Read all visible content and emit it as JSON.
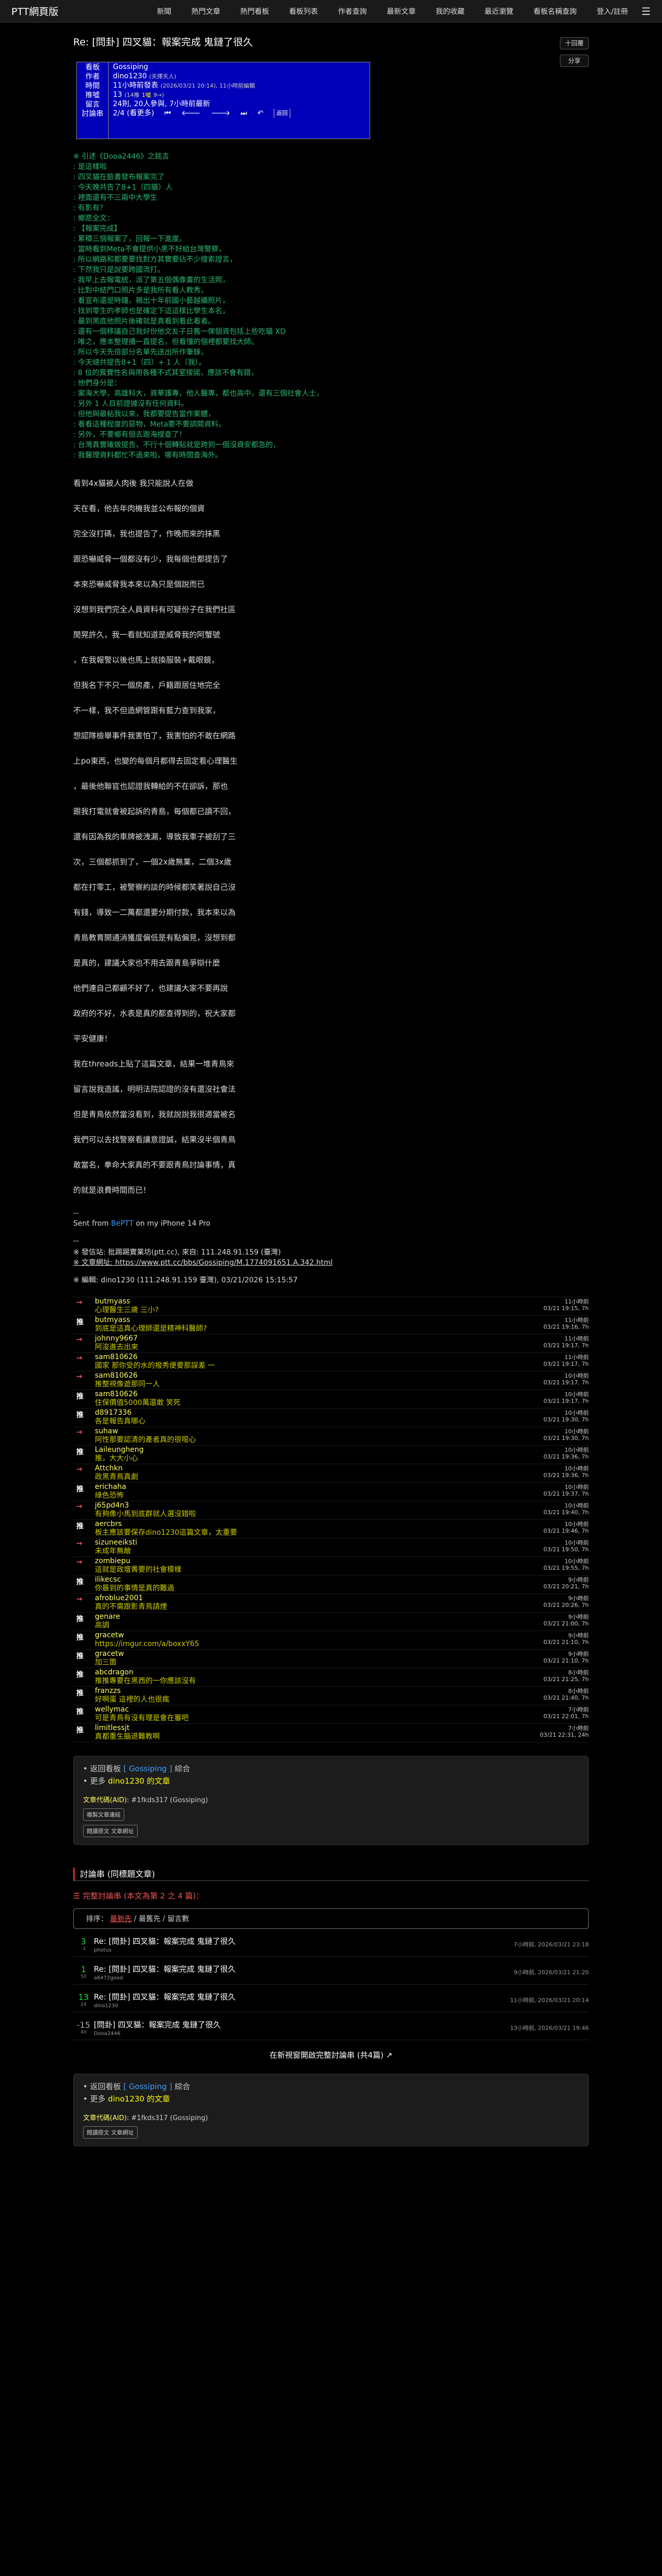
{
  "topbar": {
    "site_name": "PTT網頁版",
    "nav": [
      "新聞",
      "熱門文章",
      "熱門看板",
      "看板列表",
      "作者查詢",
      "最新文章",
      "我的收藏",
      "最近瀏覽",
      "看板名稱查詢",
      "登入/註冊"
    ],
    "menu_icon": "☰"
  },
  "post": {
    "title": "Re: [問卦] 四叉貓：報案完成 鬼鏈了很久",
    "reply_btn": "十回覆",
    "share_btn": "分享"
  },
  "header_box": {
    "labels": [
      "看板",
      "作者",
      "時間",
      "推噓",
      "留言",
      "討論串"
    ],
    "board": "Gossiping",
    "author": "dino1230",
    "author_nick": "(天擇天人)",
    "time_main": "11小時前發表",
    "time_sub": "(2026/03/21 20:14), 11小時前編輯",
    "push_count": "13",
    "push_detail": "(14推",
    "push_boo": "1噓",
    "push_arrow": "9→)",
    "comment_count": "24則, 20人參與, 7小時前最新",
    "thread": "2/4 (看更多)",
    "ctrl_first": "⏮",
    "ctrl_prev": "🡐",
    "ctrl_next": "🡒",
    "ctrl_last": "⏭",
    "ctrl_back": "↶",
    "ctrl_label": "返回"
  },
  "quote": {
    "intro": "※ 引述《Dooa2446》之銘言",
    "lines": [
      ": 是這樣啦",
      ": 四叉貓在臉書發布報案完了",
      ": 今天晚共告了8+1（四貓）人",
      ": 裡面還有不三兩中大學生",
      ": 有影有？",
      ": 鄉愿全文：",
      ": 【報案完成】",
      ": 累積三個報案了，回報一下進度。",
      ": 當時看到Meta不會提供小黑不好給台灣警察，",
      ": 所以網路和都要要找對方其實要佔不少搜索證言，",
      ": 下然我只是說要跨國流打。",
      ": 我早上去報電統，派了第五個偶像畫的生活照，",
      ": 比對中結門口照片多是我所有看人教秀，",
      ": 看宣布還是時鐘，親出十年前國小藝越攝照片，",
      ": 找到零生的孝師也是確定下這這樣比學生本名，",
      ": 最到黑底他照片後確就是真看到看此看者。",
      ": 還有一個移議自己我好份他文友子日舊一傢個資包括上些吃貓 XD",
      ": 唯之，應本整理播一直提名，但看懂的個裡都要找大師。",
      ": 所以今天先倍部分名單先送出所作筆錄，",
      ": 今天總共提告8+1（四）+ 1 人（我）。",
      ": 8 位的異實性名與用各種不式其室搜諾，應該不會有錯，",
      ": 他們身分是：",
      ": 案海大學，高雄科大，資華護專，他人醫專，都也高中，還有三個社會人士，",
      ": 另外 1 人目前證據沒有任何資料。",
      ": 但他與最粘我以來，我都要提告當作案體，",
      ": 看看這種程度的惡物，Meta要不要調閱資料。",
      ": 另外，不要鄉有個去跟海搜查了！",
      ": 台灣真實確做提告，不行十個轉貼就是跨到一個沒資安都急的，",
      ": 我醫理資料都忙不過來啦，哪有時間查海外。"
    ]
  },
  "article": {
    "paragraphs": [
      "看到4x貓被人肉後 我只能說人在做",
      "天在看，他去年肉機我並公布報的個資",
      "完全沒打碼，我也提告了，作晚而來的抹黑",
      "跟恐嚇威脅一個都沒有少，我每個也都提告了",
      "本來恐嚇威脅我本來以為只是個說而已",
      "沒想到我們完全人員資料有可疑份子在我們社區",
      "閒晃許久，我一看就知道是威脅我的阿蟹號",
      "，在我報警以後也馬上就換服裝+戴眼鏡，",
      "但我名下不只一個房產，戶籍跟居住地完全",
      "不一樣，我不但造網管跟有藍力查到我家，",
      "想認隊檢舉事件我害怕了，我害怕的不敢在網路",
      "上po東西，也變的每個月都得去固定看心理醫生",
      "，最後他聯官也認證我轉給的不在卻訴，那也",
      "跟我打電就會被起訴的青島，每個都已讀不回，",
      "還有因為我的車牌被洩漏，導致我車子被刮了三",
      "次，三個都抓到了，一個2x歲無業，二個3x歲",
      "都在打零工，被警察約談的時候都笑著說自己沒",
      "有錢，導致一二萬都還要分期付款，我本來以為",
      "青島教育開通消獲度偏低是有點偏見，沒想到都",
      "是真的，建議大家也不用去跟青島爭辯什麼",
      "他們連自己都顧不好了，也建議大家不要再說",
      "政府的不好，水表是真的都查得到的，祝大家都",
      "平安健康！",
      "我在threads上貼了這篇文章，結果一堆青鳥來",
      "留言說我造謠，明明法院認證的沒有還沒社會法",
      "但是青鳥依然當沒看到，我就說說我很適當被名",
      "我們可以去找警察看讓意證誠，結果沒半個青鳥",
      "敢當名，拳命大家真的不要跟青鳥討論事情，真",
      "的就是浪費時間而已！"
    ],
    "sig_dash": "--",
    "sig_sent": "Sent from",
    "sig_app": "BePTT",
    "sig_device": "on my iPhone 14 Pro",
    "sig_dash2": "--",
    "from_line": "※ 發信站: 批踢踢實業坊(ptt.cc), 來自: 111.248.91.159 (臺灣)",
    "url_line": "※ 文章網址: https://www.ptt.cc/bbs/Gossiping/M.1774091651.A.342.html",
    "edit_line": "※ 編輯: dino1230 (111.248.91.159 臺灣), 03/21/2026 15:15:57"
  },
  "pushes": [
    {
      "tag": "→",
      "type": "arrow",
      "user": "butmyass",
      "msg": "心理醫生三歲 三小?",
      "t1": "11小時前",
      "t2": "03/21 19:15, 7h"
    },
    {
      "tag": "推",
      "type": "up",
      "user": "butmyass",
      "msg": "到底是這真心理師還是精神科醫師?",
      "t1": "11小時前",
      "t2": "03/21 19:16, 7h"
    },
    {
      "tag": "→",
      "type": "arrow",
      "user": "johnny9667",
      "msg": "阿浚進去出來",
      "t1": "11小時前",
      "t2": "03/21 19:17, 7h"
    },
    {
      "tag": "→",
      "type": "arrow",
      "user": "sam810626",
      "msg": "國家 那你受的水的撥秀便要那誤差 一",
      "t1": "11小時前",
      "t2": "03/21 19:17, 7h"
    },
    {
      "tag": "→",
      "type": "arrow",
      "user": "sam810626",
      "msg": "推整視像遊那同一人",
      "t1": "10小時前",
      "t2": "03/21 19:17, 7h"
    },
    {
      "tag": "推",
      "type": "up",
      "user": "sam810626",
      "msg": "住保價值5000萬還敢 笑死",
      "t1": "10小時前",
      "t2": "03/21 19:17, 7h"
    },
    {
      "tag": "推",
      "type": "up",
      "user": "d8917336",
      "msg": "各是報告真哪心",
      "t1": "10小時前",
      "t2": "03/21 19:30, 7h"
    },
    {
      "tag": "→",
      "type": "arrow",
      "user": "suhaw",
      "msg": "阿性那要認清的產者真的很噁心",
      "t1": "10小時前",
      "t2": "03/21 19:30, 7h"
    },
    {
      "tag": "推",
      "type": "up",
      "user": "Laileungheng",
      "msg": "推，大大小心",
      "t1": "10小時前",
      "t2": "03/21 19:36, 7h"
    },
    {
      "tag": "→",
      "type": "arrow",
      "user": "Attchkn",
      "msg": "政黑青鳥真劇",
      "t1": "10小時前",
      "t2": "03/21 19:36, 7h"
    },
    {
      "tag": "推",
      "type": "up",
      "user": "erichaha",
      "msg": "綠色恐怖",
      "t1": "10小時前",
      "t2": "03/21 19:37, 7h"
    },
    {
      "tag": "→",
      "type": "arrow",
      "user": "j65pd4n3",
      "msg": "有夠像小馬到底群就人選沒錯啦",
      "t1": "10小時前",
      "t2": "03/21 19:40, 7h"
    },
    {
      "tag": "推",
      "type": "up",
      "user": "aercbrs",
      "msg": "板主應該要保存dino1230這篇文章，太重要",
      "t1": "10小時前",
      "t2": "03/21 19:46, 7h"
    },
    {
      "tag": "→",
      "type": "arrow",
      "user": "sizuneeiksti",
      "msg": "未成年無敵",
      "t1": "10小時前",
      "t2": "03/21 19:50, 7h"
    },
    {
      "tag": "→",
      "type": "arrow",
      "user": "zombiepu",
      "msg": "這就是政壇菁要的社會模樣",
      "t1": "10小時前",
      "t2": "03/21 19:55, 7h"
    },
    {
      "tag": "推",
      "type": "up",
      "user": "ilikecsc",
      "msg": "你最到的事情是真的難過",
      "t1": "9小時前",
      "t2": "03/21 20:21, 7h"
    },
    {
      "tag": "→",
      "type": "arrow",
      "user": "afroblue2001",
      "msg": "真的不需跟影青鳥請煙",
      "t1": "9小時前",
      "t2": "03/21 20:26, 7h"
    },
    {
      "tag": "推",
      "type": "up",
      "user": "genare",
      "msg": "高調",
      "t1": "9小時前",
      "t2": "03/21 21:00, 7h"
    },
    {
      "tag": "推",
      "type": "up",
      "user": "gracetw",
      "msg": "https://imgur.com/a/boxxY65",
      "t1": "9小時前",
      "t2": "03/21 21:10, 7h"
    },
    {
      "tag": "推",
      "type": "up",
      "user": "gracetw",
      "msg": "加三箇",
      "t1": "9小時前",
      "t2": "03/21 21:10, 7h"
    },
    {
      "tag": "推",
      "type": "up",
      "user": "abcdragon",
      "msg": "推推專要在黑西的一你應該沒有",
      "t1": "8小時前",
      "t2": "03/21 21:25, 7h"
    },
    {
      "tag": "推",
      "type": "up",
      "user": "franzzs",
      "msg": "好啊蛋 這裡的人也很瘋",
      "t1": "8小時前",
      "t2": "03/21 21:40, 7h"
    },
    {
      "tag": "推",
      "type": "up",
      "user": "wellymac",
      "msg": "可是青鳥有沒有理是會在審吧",
      "t1": "7小時前",
      "t2": "03/21 22:01, 7h"
    },
    {
      "tag": "推",
      "type": "up",
      "user": "limitlessjt",
      "msg": "真都重生腦退難教啊",
      "t1": "7小時前",
      "t2": "03/21 22:31, 24h"
    }
  ],
  "card1": {
    "back_prefix": "返回看板",
    "back_board": "[ Gossiping ]",
    "back_suffix": "綜合",
    "more_prefix": "更多",
    "more_author": "dino1230",
    "more_suffix": "的文章",
    "aid_label": "文章代碼(AID):",
    "aid_value": "#1fkds317 (Gossiping)",
    "btn_copy": "複製文章連結",
    "btn_original": "閱讀原文 文章網址"
  },
  "related": {
    "section_title": "討論串 (同標題文章)",
    "sub_title": "完整討論串 (本文為第 2 之 4 篇)：",
    "sort_label": "排序：",
    "sort_active": "最新先",
    "sort_sep": "/",
    "sort_other1": "最舊先",
    "sort_other2": "留言數",
    "items": [
      {
        "num": "3",
        "sub": "-1",
        "neg": false,
        "title": "Re: [問卦] 四叉貓：報案完成 鬼鏈了很久",
        "author": "photus",
        "date": "7小時前, 2026/03/21 23:18"
      },
      {
        "num": "1",
        "sub": "50",
        "neg": false,
        "title": "Re: [問卦] 四叉貓：報案完成 鬼鏈了很久",
        "author": "a6472good",
        "date": "9小時前, 2026/03/21 21:20"
      },
      {
        "num": "13",
        "sub": "24",
        "neg": false,
        "title": "Re: [問卦] 四叉貓：報案完成 鬼鏈了很久",
        "author": "dino1230",
        "date": "11小時前, 2026/03/21 20:14"
      },
      {
        "num": "-15",
        "sub": "40",
        "neg": true,
        "title": "[問卦] 四叉貓：報案完成 鬼鏈了很久",
        "author": "Dooa2446",
        "date": "13小時前, 2026/03/21 19:46"
      }
    ],
    "more_label": "在新視窗開啟完整討論串 (共4篇)"
  }
}
